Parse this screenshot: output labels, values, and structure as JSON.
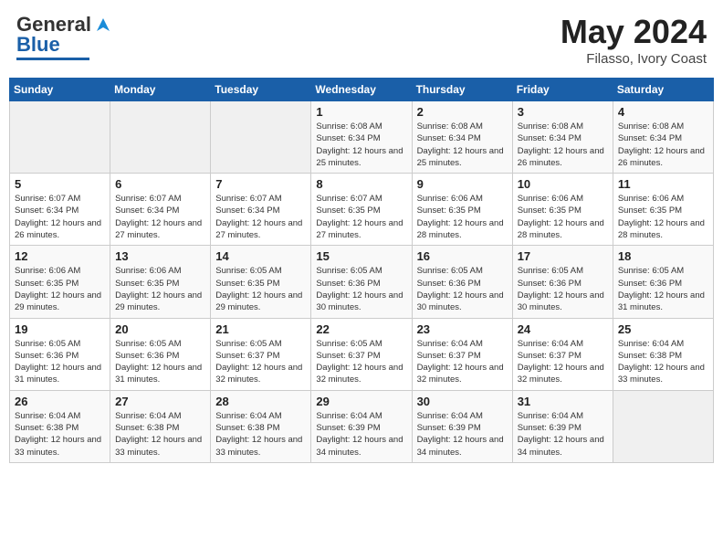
{
  "header": {
    "logo_general": "General",
    "logo_blue": "Blue",
    "month_year": "May 2024",
    "location": "Filasso, Ivory Coast"
  },
  "days_of_week": [
    "Sunday",
    "Monday",
    "Tuesday",
    "Wednesday",
    "Thursday",
    "Friday",
    "Saturday"
  ],
  "weeks": [
    [
      {
        "day": "",
        "empty": true
      },
      {
        "day": "",
        "empty": true
      },
      {
        "day": "",
        "empty": true
      },
      {
        "day": "1",
        "sunrise": "6:08 AM",
        "sunset": "6:34 PM",
        "daylight": "12 hours and 25 minutes."
      },
      {
        "day": "2",
        "sunrise": "6:08 AM",
        "sunset": "6:34 PM",
        "daylight": "12 hours and 25 minutes."
      },
      {
        "day": "3",
        "sunrise": "6:08 AM",
        "sunset": "6:34 PM",
        "daylight": "12 hours and 26 minutes."
      },
      {
        "day": "4",
        "sunrise": "6:08 AM",
        "sunset": "6:34 PM",
        "daylight": "12 hours and 26 minutes."
      }
    ],
    [
      {
        "day": "5",
        "sunrise": "6:07 AM",
        "sunset": "6:34 PM",
        "daylight": "12 hours and 26 minutes."
      },
      {
        "day": "6",
        "sunrise": "6:07 AM",
        "sunset": "6:34 PM",
        "daylight": "12 hours and 27 minutes."
      },
      {
        "day": "7",
        "sunrise": "6:07 AM",
        "sunset": "6:34 PM",
        "daylight": "12 hours and 27 minutes."
      },
      {
        "day": "8",
        "sunrise": "6:07 AM",
        "sunset": "6:35 PM",
        "daylight": "12 hours and 27 minutes."
      },
      {
        "day": "9",
        "sunrise": "6:06 AM",
        "sunset": "6:35 PM",
        "daylight": "12 hours and 28 minutes."
      },
      {
        "day": "10",
        "sunrise": "6:06 AM",
        "sunset": "6:35 PM",
        "daylight": "12 hours and 28 minutes."
      },
      {
        "day": "11",
        "sunrise": "6:06 AM",
        "sunset": "6:35 PM",
        "daylight": "12 hours and 28 minutes."
      }
    ],
    [
      {
        "day": "12",
        "sunrise": "6:06 AM",
        "sunset": "6:35 PM",
        "daylight": "12 hours and 29 minutes."
      },
      {
        "day": "13",
        "sunrise": "6:06 AM",
        "sunset": "6:35 PM",
        "daylight": "12 hours and 29 minutes."
      },
      {
        "day": "14",
        "sunrise": "6:05 AM",
        "sunset": "6:35 PM",
        "daylight": "12 hours and 29 minutes."
      },
      {
        "day": "15",
        "sunrise": "6:05 AM",
        "sunset": "6:36 PM",
        "daylight": "12 hours and 30 minutes."
      },
      {
        "day": "16",
        "sunrise": "6:05 AM",
        "sunset": "6:36 PM",
        "daylight": "12 hours and 30 minutes."
      },
      {
        "day": "17",
        "sunrise": "6:05 AM",
        "sunset": "6:36 PM",
        "daylight": "12 hours and 30 minutes."
      },
      {
        "day": "18",
        "sunrise": "6:05 AM",
        "sunset": "6:36 PM",
        "daylight": "12 hours and 31 minutes."
      }
    ],
    [
      {
        "day": "19",
        "sunrise": "6:05 AM",
        "sunset": "6:36 PM",
        "daylight": "12 hours and 31 minutes."
      },
      {
        "day": "20",
        "sunrise": "6:05 AM",
        "sunset": "6:36 PM",
        "daylight": "12 hours and 31 minutes."
      },
      {
        "day": "21",
        "sunrise": "6:05 AM",
        "sunset": "6:37 PM",
        "daylight": "12 hours and 32 minutes."
      },
      {
        "day": "22",
        "sunrise": "6:05 AM",
        "sunset": "6:37 PM",
        "daylight": "12 hours and 32 minutes."
      },
      {
        "day": "23",
        "sunrise": "6:04 AM",
        "sunset": "6:37 PM",
        "daylight": "12 hours and 32 minutes."
      },
      {
        "day": "24",
        "sunrise": "6:04 AM",
        "sunset": "6:37 PM",
        "daylight": "12 hours and 32 minutes."
      },
      {
        "day": "25",
        "sunrise": "6:04 AM",
        "sunset": "6:38 PM",
        "daylight": "12 hours and 33 minutes."
      }
    ],
    [
      {
        "day": "26",
        "sunrise": "6:04 AM",
        "sunset": "6:38 PM",
        "daylight": "12 hours and 33 minutes."
      },
      {
        "day": "27",
        "sunrise": "6:04 AM",
        "sunset": "6:38 PM",
        "daylight": "12 hours and 33 minutes."
      },
      {
        "day": "28",
        "sunrise": "6:04 AM",
        "sunset": "6:38 PM",
        "daylight": "12 hours and 33 minutes."
      },
      {
        "day": "29",
        "sunrise": "6:04 AM",
        "sunset": "6:39 PM",
        "daylight": "12 hours and 34 minutes."
      },
      {
        "day": "30",
        "sunrise": "6:04 AM",
        "sunset": "6:39 PM",
        "daylight": "12 hours and 34 minutes."
      },
      {
        "day": "31",
        "sunrise": "6:04 AM",
        "sunset": "6:39 PM",
        "daylight": "12 hours and 34 minutes."
      },
      {
        "day": "",
        "empty": true
      }
    ]
  ],
  "labels": {
    "sunrise": "Sunrise:",
    "sunset": "Sunset:",
    "daylight": "Daylight:"
  }
}
